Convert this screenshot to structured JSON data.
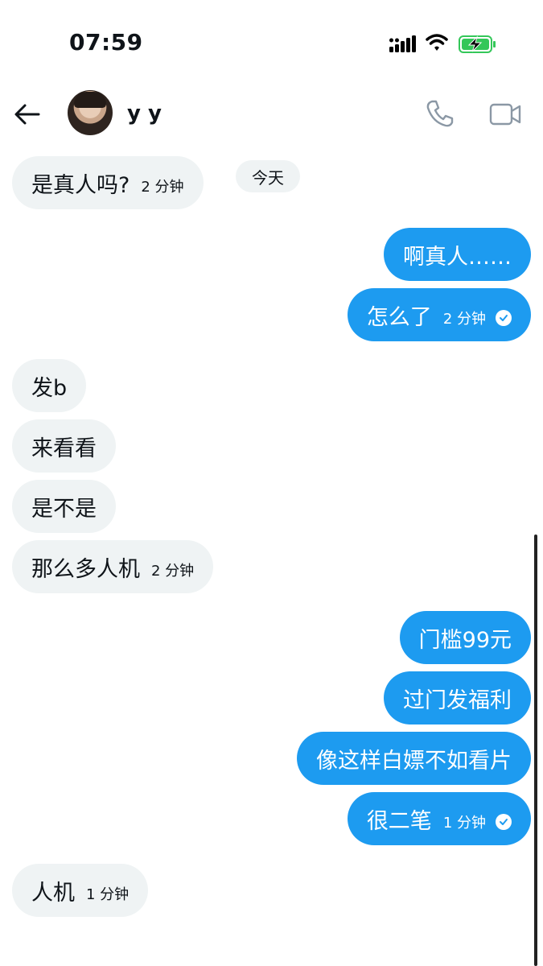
{
  "status_bar": {
    "time": "07:59"
  },
  "header": {
    "contact_name": "y y"
  },
  "date_separator": "今天",
  "messages": [
    {
      "text": "是真人吗?",
      "time": "2 分钟"
    },
    {
      "text": "啊真人……"
    },
    {
      "text": "怎么了",
      "time": "2 分钟"
    },
    {
      "text": "发b"
    },
    {
      "text": "来看看"
    },
    {
      "text": "是不是"
    },
    {
      "text": "那么多人机",
      "time": "2 分钟"
    },
    {
      "text": "门槛99元"
    },
    {
      "text": "过门发福利"
    },
    {
      "text": "像这样白嫖不如看片"
    },
    {
      "text": "很二笔",
      "time": "1 分钟"
    },
    {
      "text": "人机",
      "time": "1 分钟"
    }
  ],
  "colors": {
    "outgoing_bubble": "#1d9bf0",
    "incoming_bubble": "#eff3f4",
    "battery_fill": "#34c759"
  },
  "icons": [
    "back-arrow-icon",
    "phone-icon",
    "video-camera-icon",
    "signal-icon",
    "wifi-icon",
    "battery-charging-icon",
    "read-check-icon"
  ]
}
